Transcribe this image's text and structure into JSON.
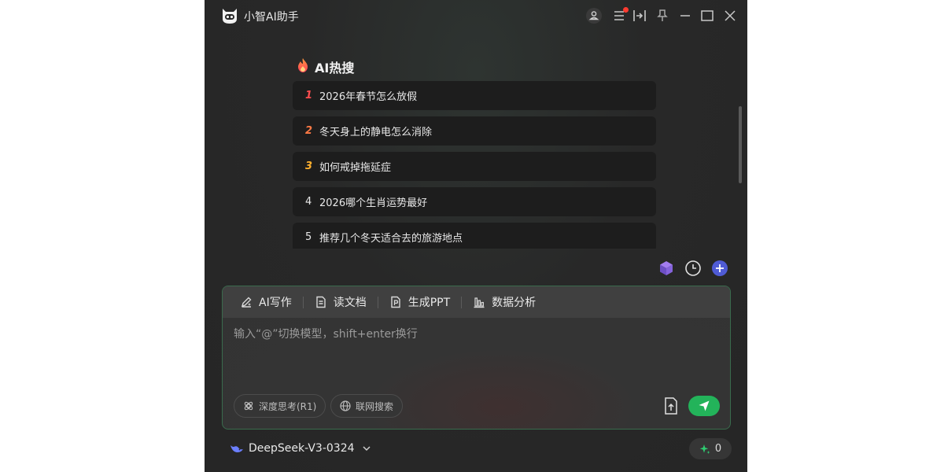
{
  "app": {
    "title": "小智AI助手"
  },
  "hot": {
    "title": "AI热搜",
    "items": [
      {
        "rank": "1",
        "text": "2026年春节怎么放假"
      },
      {
        "rank": "2",
        "text": "冬天身上的静电怎么消除"
      },
      {
        "rank": "3",
        "text": "如何戒掉拖延症"
      },
      {
        "rank": "4",
        "text": "2026哪个生肖运势最好"
      },
      {
        "rank": "5",
        "text": "推荐几个冬天适合去的旅游地点"
      }
    ]
  },
  "tools": [
    {
      "label": "AI写作",
      "icon": "pen-icon"
    },
    {
      "label": "读文档",
      "icon": "document-icon"
    },
    {
      "label": "生成PPT",
      "icon": "ppt-icon"
    },
    {
      "label": "数据分析",
      "icon": "bar-chart-icon"
    }
  ],
  "input": {
    "placeholder": "输入“@”切换模型，shift+enter换行"
  },
  "chips": {
    "deep_think": "深度思考(R1)",
    "web_search": "联网搜索"
  },
  "model": {
    "name": "DeepSeek-V3-0324"
  },
  "credits": {
    "count": "0"
  },
  "colors": {
    "accent": "#23b35a",
    "rank1": "#ff4d4f",
    "rank2": "#ff7a45",
    "rank3": "#ffb02e",
    "background": "#282828"
  }
}
